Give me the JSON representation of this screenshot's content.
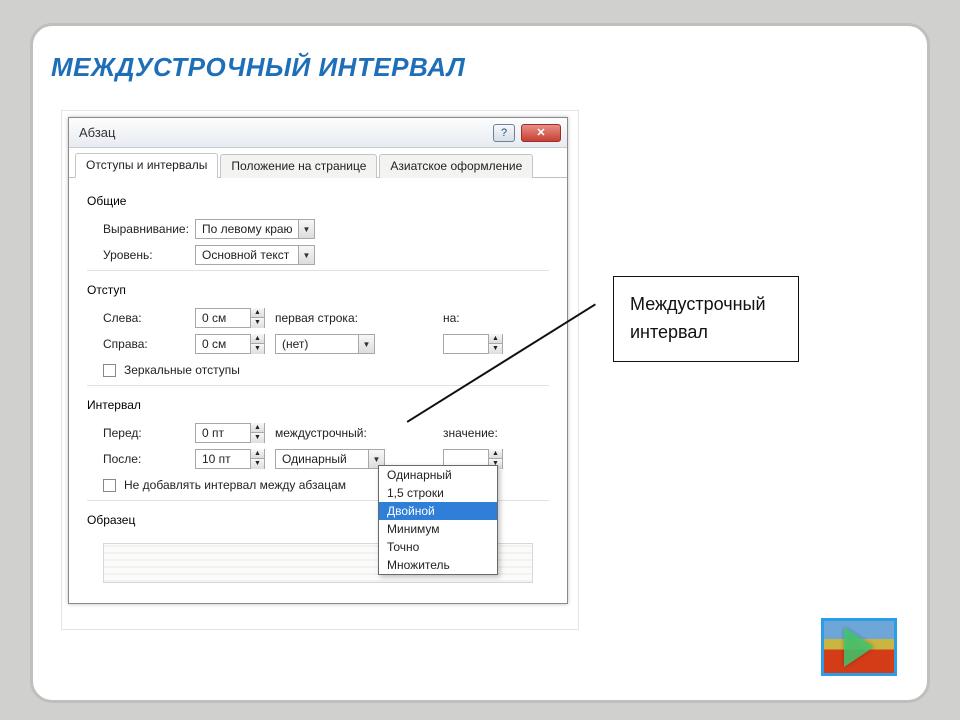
{
  "slide": {
    "title": "МЕЖДУСТРОЧНЫЙ ИНТЕРВАЛ"
  },
  "dialog": {
    "title": "Абзац",
    "tabs": [
      "Отступы и интервалы",
      "Положение на странице",
      "Азиатское оформление"
    ],
    "sections": {
      "general_label": "Общие",
      "align_label": "Выравнивание:",
      "align_value": "По левому краю",
      "level_label": "Уровень:",
      "level_value": "Основной текст",
      "indent_label": "Отступ",
      "left_label": "Слева:",
      "left_value": "0 см",
      "right_label": "Справа:",
      "right_value": "0 см",
      "firstline_label": "первая строка:",
      "firstline_value": "(нет)",
      "by_label": "на:",
      "by_value": "",
      "mirror_label": "Зеркальные отступы",
      "spacing_label": "Интервал",
      "before_label": "Перед:",
      "before_value": "0 пт",
      "after_label": "После:",
      "after_value": "10 пт",
      "linespacing_label": "междустрочный:",
      "linespacing_value": "Одинарный",
      "value_label": "значение:",
      "value_value": "",
      "noadd_label": "Не добавлять интервал между абзацам",
      "preview_label": "Образец"
    },
    "linespacing_options": [
      "Одинарный",
      "1,5 строки",
      "Двойной",
      "Минимум",
      "Точно",
      "Множитель"
    ],
    "linespacing_selected_index": 2
  },
  "annotation": {
    "text": "Междустрочный интервал"
  },
  "nav": {
    "name": "next-slide"
  }
}
